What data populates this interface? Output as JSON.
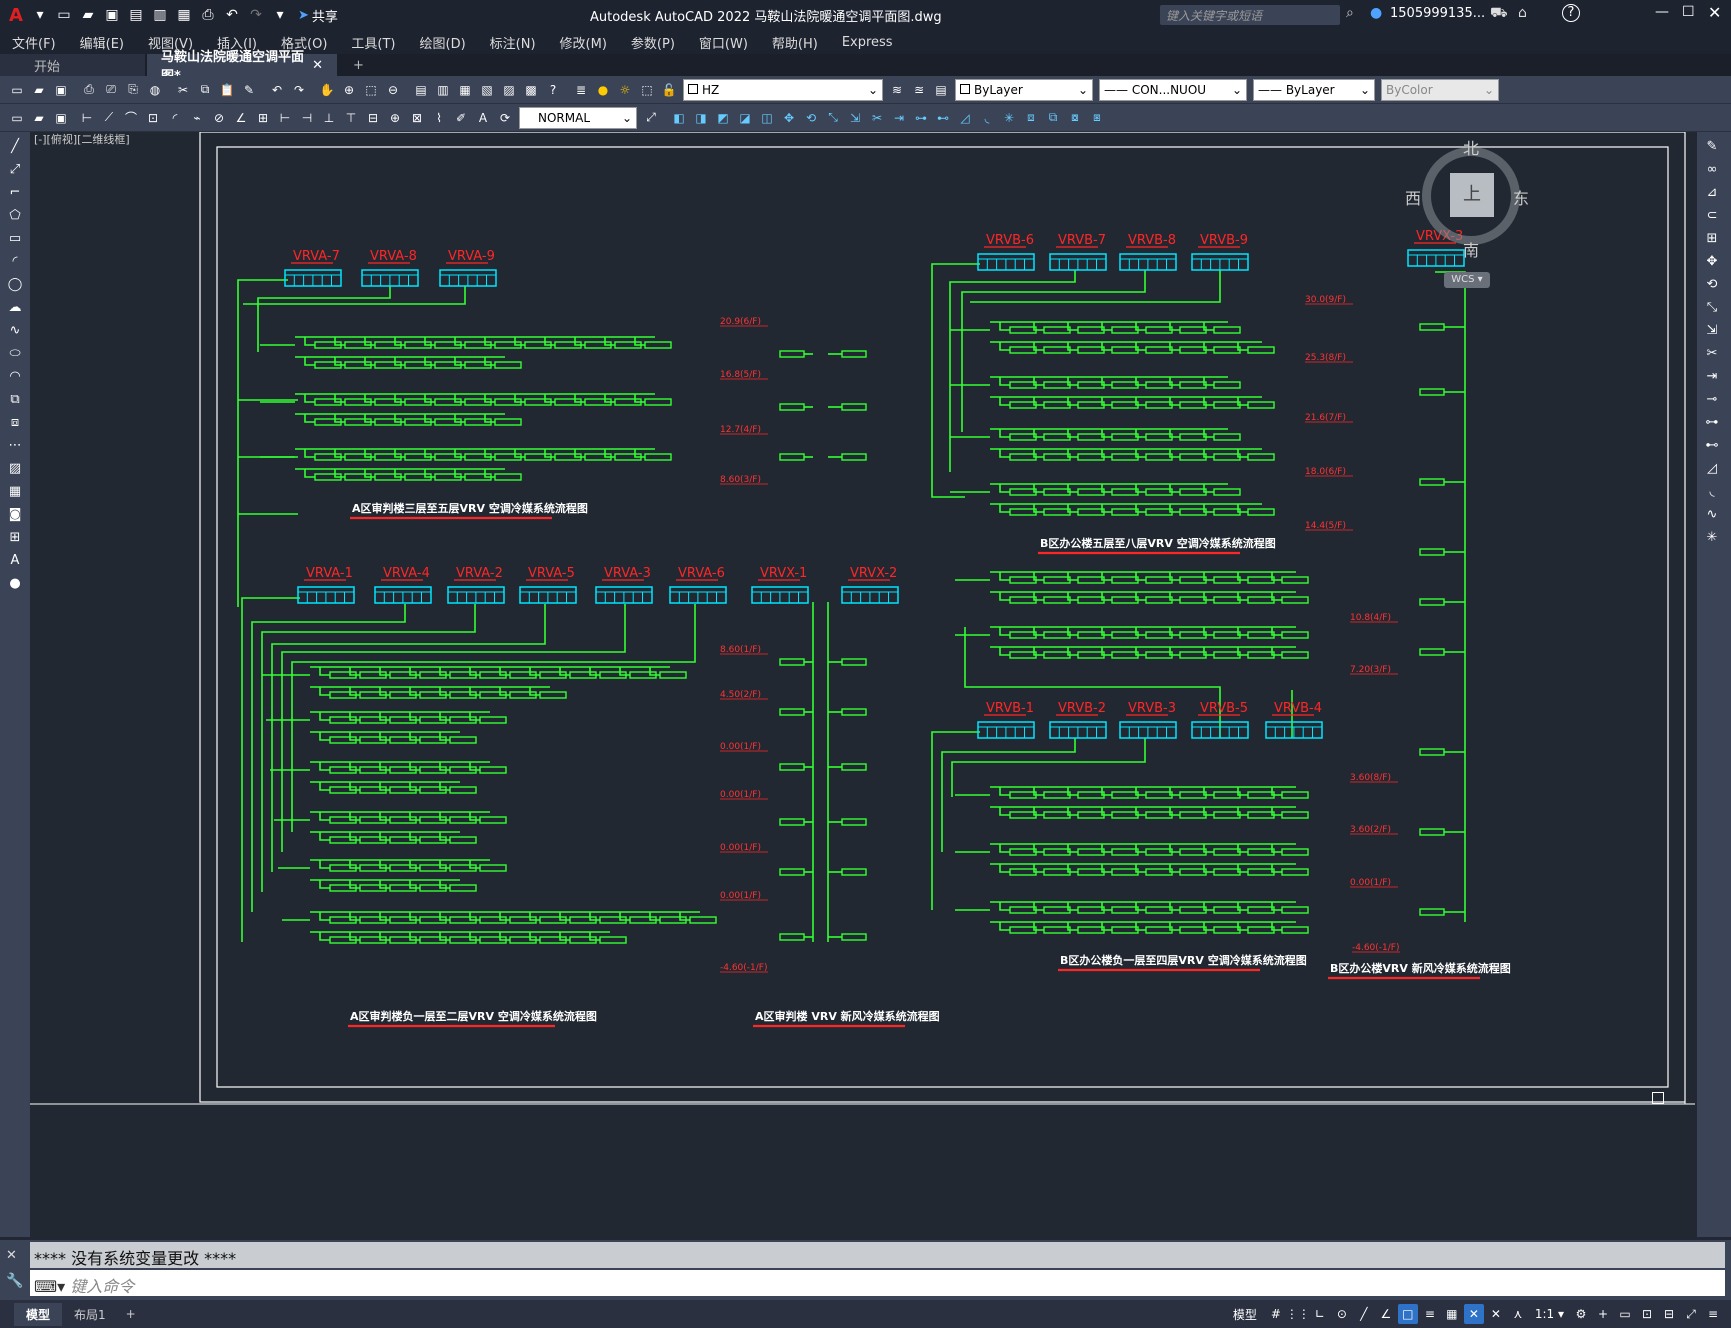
{
  "titlebar": {
    "app_letter": "A",
    "share_label": "共享",
    "title": "Autodesk AutoCAD 2022    马鞍山法院暖通空调平面图.dwg",
    "search_placeholder": "键入关键字或短语",
    "user": "1505999135...",
    "help": "?"
  },
  "menu": [
    "文件(F)",
    "编辑(E)",
    "视图(V)",
    "插入(I)",
    "格式(O)",
    "工具(T)",
    "绘图(D)",
    "标注(N)",
    "修改(M)",
    "参数(P)",
    "窗口(W)",
    "帮助(H)",
    "Express"
  ],
  "tabs": {
    "start": "开始",
    "doc": "马鞍山法院暖通空调平面图*",
    "add": "+"
  },
  "toolbar": {
    "layer": "HZ",
    "color": "ByLayer",
    "linetype": "CON...NUOU",
    "lineweight": "ByLayer",
    "plotstyle": "ByColor",
    "textstyle": "NORMAL"
  },
  "viewport": {
    "label": "[-][俯视][二维线框]"
  },
  "viewcube": {
    "north": "北",
    "south": "南",
    "east": "东",
    "west": "西",
    "top": "上",
    "wcs": "WCS"
  },
  "drawing": {
    "unit_labels_a_upper": [
      "VRVA-7",
      "VRVA-8",
      "VRVA-9"
    ],
    "unit_labels_a_lower": [
      "VRVA-1",
      "VRVA-4",
      "VRVA-2",
      "VRVA-5",
      "VRVA-3",
      "VRVA-6",
      "VRVX-1",
      "VRVX-2"
    ],
    "unit_labels_b_upper": [
      "VRVB-6",
      "VRVB-7",
      "VRVB-8",
      "VRVB-9",
      "VRVX-3"
    ],
    "unit_labels_b_lower": [
      "VRVB-1",
      "VRVB-2",
      "VRVB-3",
      "VRVB-5",
      "VRVB-4"
    ],
    "levels_a": [
      "20.9(6/F)",
      "16.8(5/F)",
      "12.7(4/F)",
      "8.60(3/F)",
      "8.60(1/F)",
      "4.50(2/F)",
      "0.00(1/F)",
      "0.00(1/F)",
      "0.00(1/F)",
      "0.00(1/F)",
      "-4.60(-1/F)"
    ],
    "levels_b": [
      "30.0(9/F)",
      "25.3(8/F)",
      "21.6(7/F)",
      "18.0(6/F)",
      "14.4(5/F)",
      "10.8(4/F)",
      "7.20(3/F)",
      "3.60(8/F)",
      "3.60(2/F)",
      "0.00(1/F)",
      "-4.60(-1/F)"
    ],
    "captions": {
      "a_upper": "A区审判楼三层至五层VRV  空调冷媒系统流程图",
      "a_lower": "A区审判楼负一层至二层VRV  空调冷媒系统流程图",
      "a_fresh": "A区审判楼 VRV  新风冷媒系统流程图",
      "b_upper": "B区办公楼五层至八层VRV  空调冷媒系统流程图",
      "b_lower": "B区办公楼负一层至四层VRV  空调冷媒系统流程图",
      "b_fresh": "B区办公楼VRV  新风冷媒系统流程图"
    }
  },
  "command": {
    "history": "****  没有系统变量更改  ****",
    "placeholder": "键入命令"
  },
  "status": {
    "tab_model": "模型",
    "tab_layout": "布局1",
    "add": "+",
    "model_btn": "模型",
    "scale": "1:1"
  },
  "colors": {
    "pipe": "#33ff33",
    "unit": "#00e6ff",
    "label": "#ff2626",
    "background": "#212831"
  }
}
